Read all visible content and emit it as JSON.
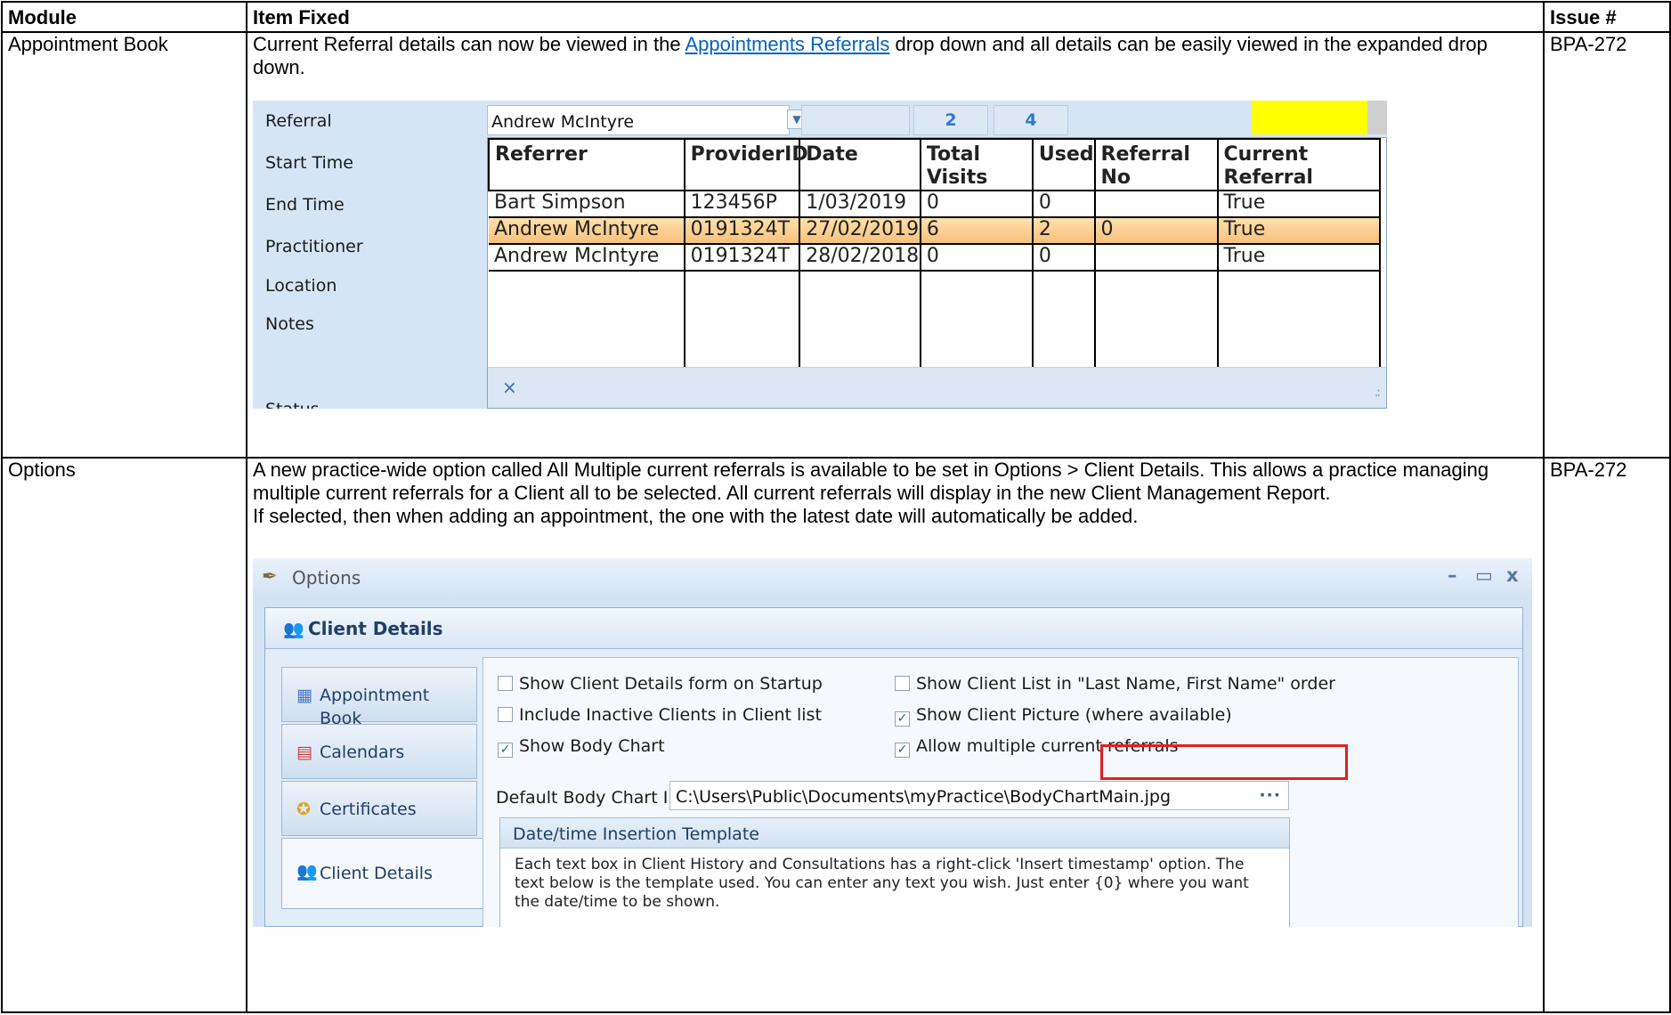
{
  "table": {
    "headers": {
      "module": "Module",
      "item_fixed": "Item Fixed",
      "issue": "Issue #"
    },
    "rows": [
      {
        "module": "Appointment Book",
        "text_before_link": "Current Referral details can now be viewed in the ",
        "link": "Appointments Referrals",
        "text_after_link": " drop down and all details can be easily viewed in the expanded drop down.",
        "issue": "BPA-272"
      },
      {
        "module": "Options",
        "para1": "A new practice-wide option called All Multiple current referrals is available to be set in Options > Client Details. This allows a practice managing multiple current referrals for a Client all to be selected. All current referrals will display in the new Client Management Report.",
        "para2": "If selected, then when adding an appointment, the one with the latest date will automatically be added.",
        "issue": "BPA-272"
      }
    ]
  },
  "referral_screen": {
    "labels": [
      "Referral",
      "Start Time",
      "End Time",
      "Practitioner",
      "Location",
      "Notes",
      "Status"
    ],
    "combo_value": "Andrew McIntyre",
    "count1": "2",
    "count2": "4",
    "columns": [
      "Referrer",
      "ProviderID",
      "Date",
      "Total Visits",
      "Used",
      "Referral No",
      "Current Referral"
    ],
    "rows": [
      [
        "Bart  Simpson",
        "123456P",
        "1/03/2019",
        "0",
        "0",
        "",
        "True"
      ],
      [
        "Andrew McIntyre",
        "0191324T",
        "27/02/2019",
        "6",
        "2",
        "0",
        "True"
      ],
      [
        "Andrew McIntyre",
        "0191324T",
        "28/02/2018",
        "0",
        "0",
        "",
        "True"
      ]
    ],
    "selected_row": 1,
    "footer_close": "×",
    "grip": ".:"
  },
  "options_screen": {
    "window_title": "Options",
    "title_icon": "options-feather-icon",
    "win_min": "–",
    "win_max": "▭",
    "win_close": "x",
    "group_title": "Client Details",
    "nav": [
      {
        "label": "Appointment Book",
        "icon": "appointment-book-icon",
        "glyph": "▦"
      },
      {
        "label": "Calendars",
        "icon": "calendar-icon",
        "glyph": "▤"
      },
      {
        "label": "Certificates",
        "icon": "certificate-icon",
        "glyph": "✪"
      },
      {
        "label": "Client Details",
        "icon": "client-details-icon",
        "glyph": "👥"
      }
    ],
    "checks": [
      {
        "label": "Show Client Details form on Startup",
        "checked": false
      },
      {
        "label": "Show Client List in \"Last Name, First Name\" order",
        "checked": false
      },
      {
        "label": "Include Inactive Clients in Client list",
        "checked": false
      },
      {
        "label": "Show Client Picture (where available)",
        "checked": true
      },
      {
        "label": "Show Body Chart",
        "checked": true
      },
      {
        "label": "Allow multiple current referrals",
        "checked": true
      }
    ],
    "check_mark": "✓",
    "body_chart_label": "Default Body Chart Image",
    "body_chart_value": "C:\\Users\\Public\\Documents\\myPractice\\BodyChartMain.jpg",
    "browse": "···",
    "template_title": "Date/time Insertion Template",
    "template_text": "Each text box in Client History and Consultations has a right-click 'Insert timestamp' option.  The text below is the template used. You can enter any text you wish. Just enter {0} where you want the date/time to be shown."
  },
  "colors": {
    "link": "#0563c1",
    "highlight_box": "#e02020",
    "yellow_indicator": "#ffff00",
    "selected_row": "#f9c07b"
  }
}
